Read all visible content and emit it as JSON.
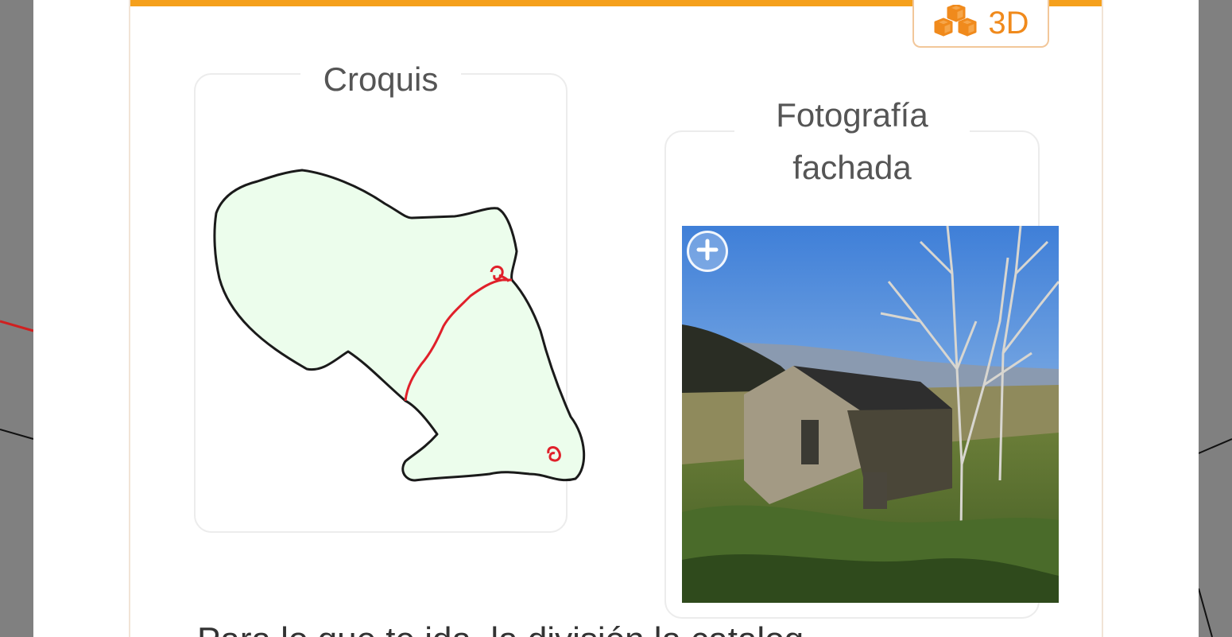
{
  "toolbar": {
    "button_3d_label": "3D",
    "button_3d_icon": "cubes-icon",
    "accent_color": "#f5a01c"
  },
  "sketch_panel": {
    "title": "Croquis",
    "fill_color": "#ecfdec",
    "outline_color": "#1a1a1a",
    "subdivision_color": "#e0202a"
  },
  "photo_panel": {
    "title": "Fotografía fachada",
    "zoom_icon": "zoom-in-icon"
  },
  "description": {
    "text": "Para lo que te ida, la división la catalog"
  }
}
